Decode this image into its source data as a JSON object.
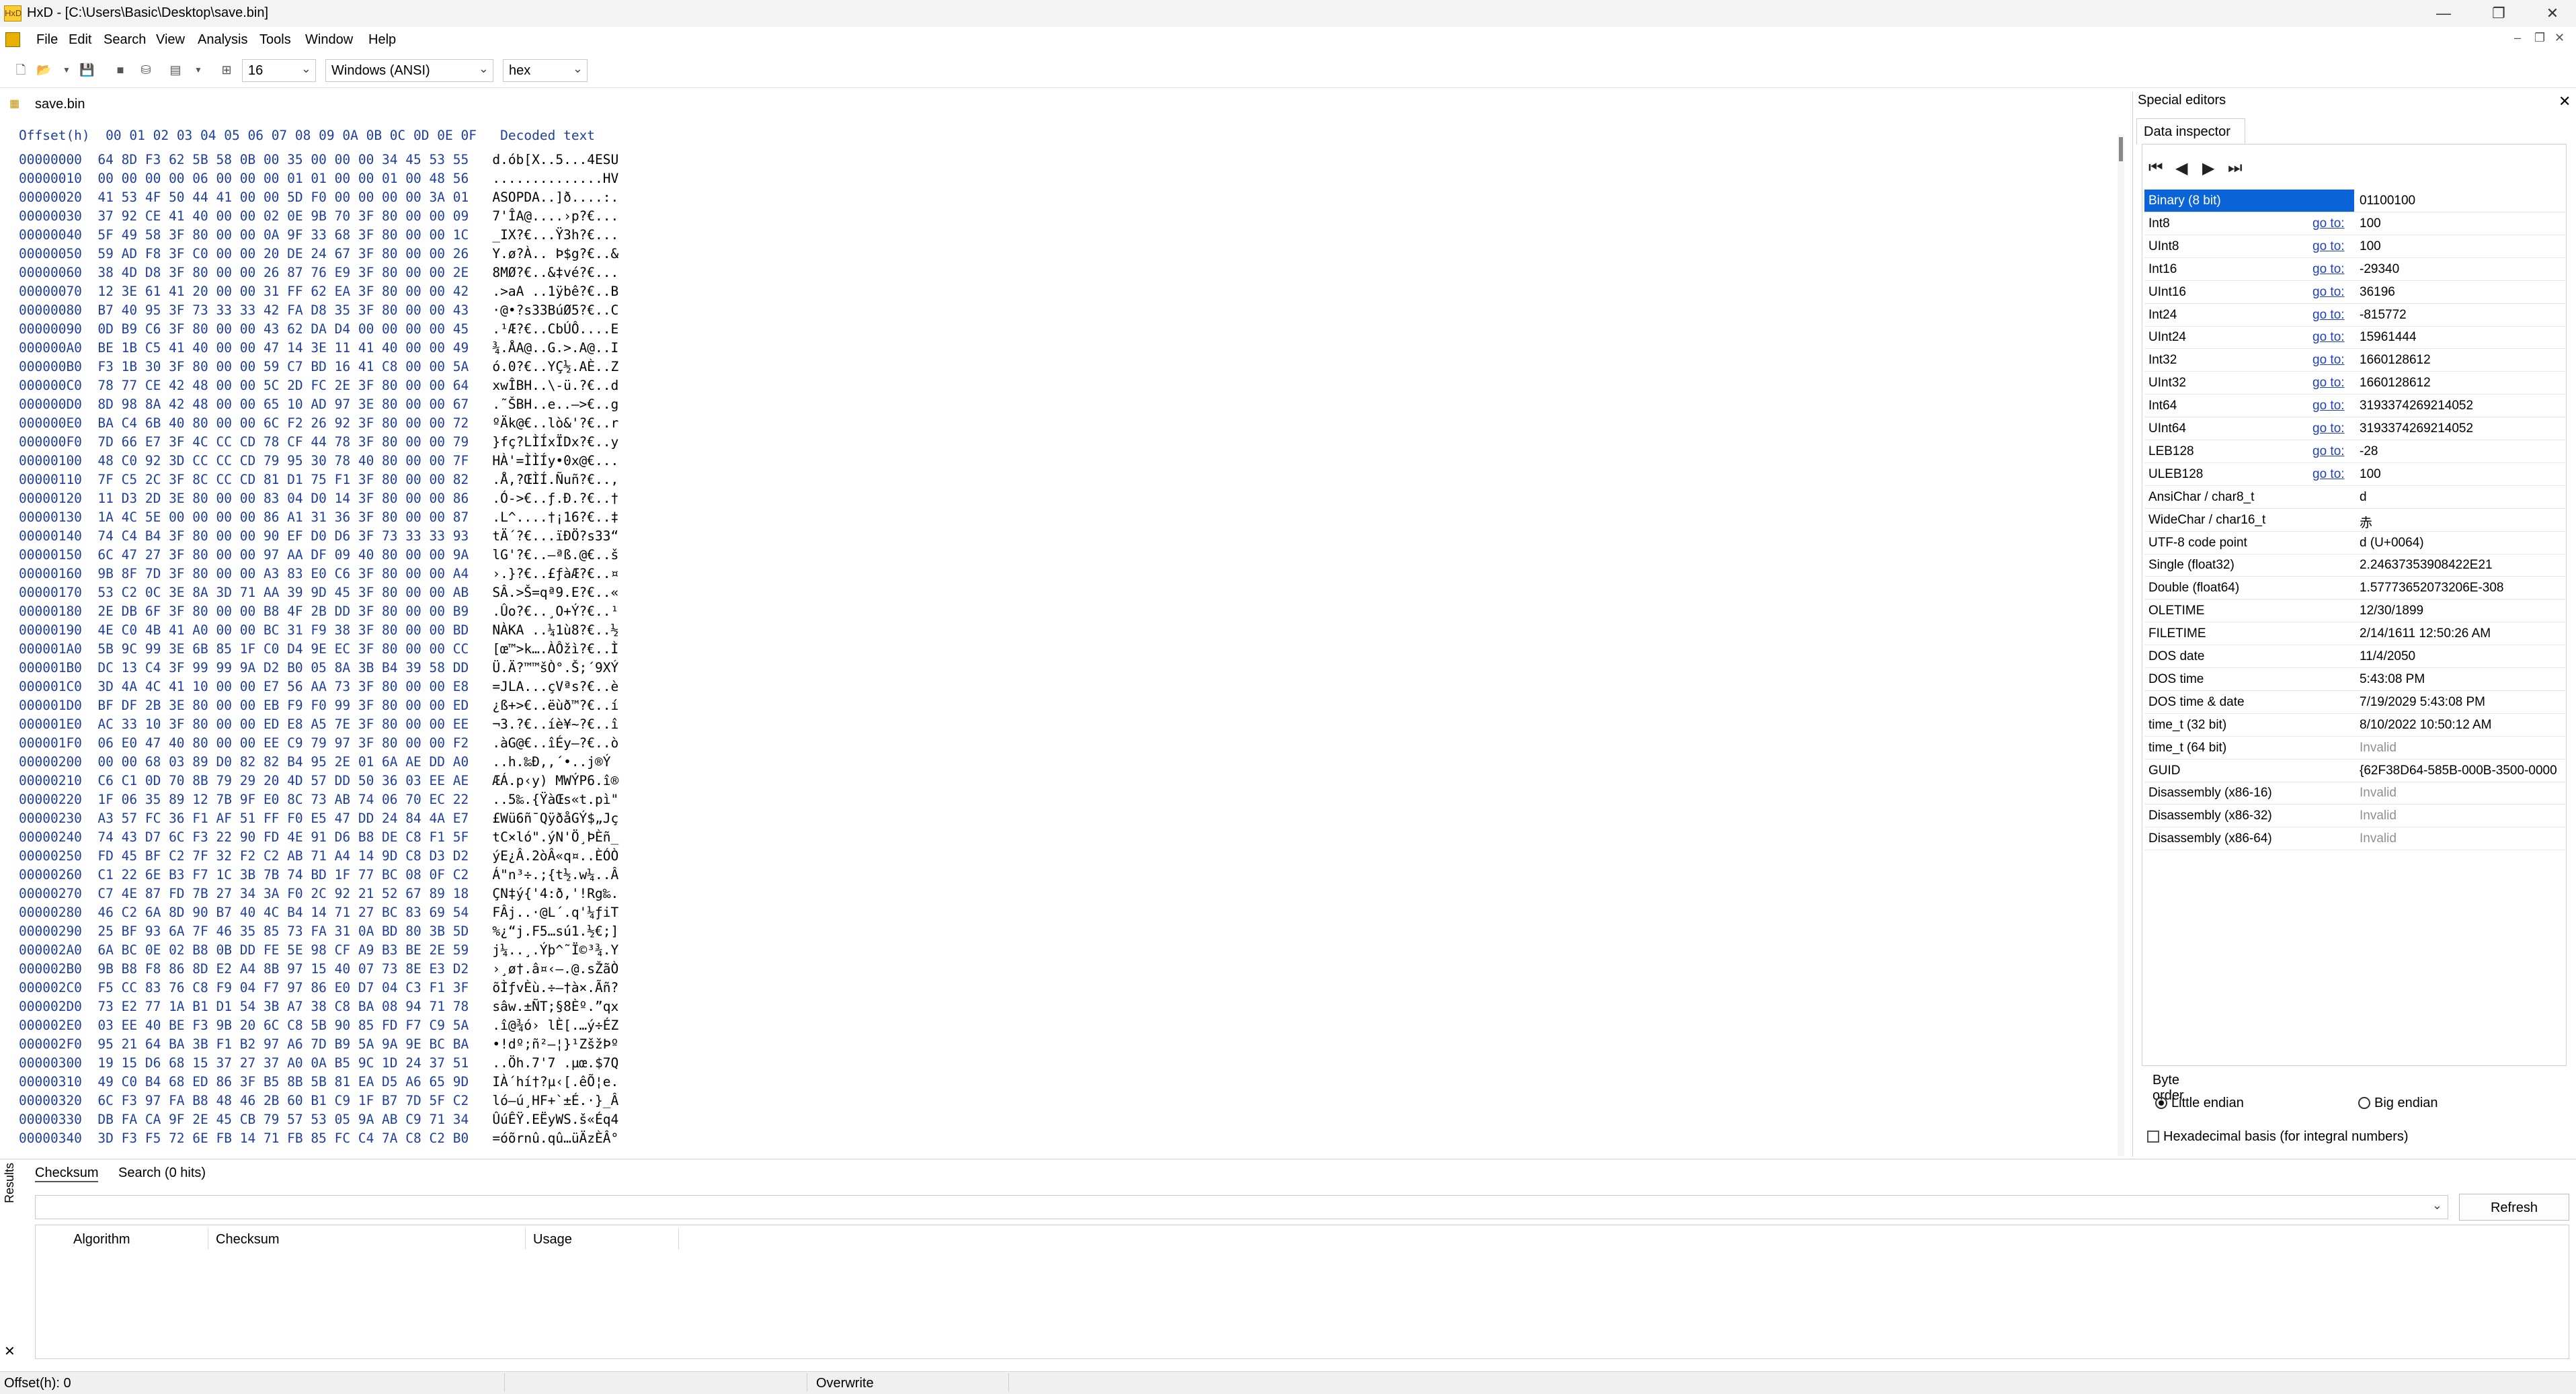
{
  "window": {
    "title": "HxD - [C:\\Users\\Basic\\Desktop\\save.bin]",
    "minimize": "—",
    "maximize": "❐",
    "close": "✕"
  },
  "menu": [
    "File",
    "Edit",
    "Search",
    "View",
    "Analysis",
    "Tools",
    "Window",
    "Help"
  ],
  "toolbar": {
    "bytes_per_row": "16",
    "charset": "Windows (ANSI)",
    "display": "hex"
  },
  "file_tab": "save.bin",
  "hex": {
    "header_offset": "Offset(h)",
    "header_columns": "00 01 02 03 04 05 06 07 08 09 0A 0B 0C 0D 0E 0F",
    "header_decoded": "Decoded text",
    "rows": [
      [
        "00000000",
        "64 8D F3 62 5B 58 0B 00 35 00 00 00 34 45 53 55",
        "d.ób[X..5...4ESU"
      ],
      [
        "00000010",
        "00 00 00 00 06 00 00 00 01 01 00 00 01 00 48 56",
        "..............HV"
      ],
      [
        "00000020",
        "41 53 4F 50 44 41 00 00 5D F0 00 00 00 00 3A 01",
        "ASOPDA..]ð....:."
      ],
      [
        "00000030",
        "37 92 CE 41 40 00 00 02 0E 9B 70 3F 80 00 00 09",
        "7'ÎA@....›p?€..."
      ],
      [
        "00000040",
        "5F 49 58 3F 80 00 00 0A 9F 33 68 3F 80 00 00 1C",
        "_IX?€...Ÿ3h?€..."
      ],
      [
        "00000050",
        "59 AD F8 3F C0 00 00 20 DE 24 67 3F 80 00 00 26",
        "Y.ø?À.. Þ$g?€..&"
      ],
      [
        "00000060",
        "38 4D D8 3F 80 00 00 26 87 76 E9 3F 80 00 00 2E",
        "8MØ?€..&‡vé?€..."
      ],
      [
        "00000070",
        "12 3E 61 41 20 00 00 31 FF 62 EA 3F 80 00 00 42",
        ".>aA ..1ÿbê?€..B"
      ],
      [
        "00000080",
        "B7 40 95 3F 73 33 33 42 FA D8 35 3F 80 00 00 43",
        "·@•?s33BúØ5?€..C"
      ],
      [
        "00000090",
        "0D B9 C6 3F 80 00 00 43 62 DA D4 00 00 00 00 45",
        ".¹Æ?€..CbÚÔ....E"
      ],
      [
        "000000A0",
        "BE 1B C5 41 40 00 00 47 14 3E 11 41 40 00 00 49",
        "¾.ÅA@..G.>.A@..I"
      ],
      [
        "000000B0",
        "F3 1B 30 3F 80 00 00 59 C7 BD 16 41 C8 00 00 5A",
        "ó.0?€..YÇ½.AÈ..Z"
      ],
      [
        "000000C0",
        "78 77 CE 42 48 00 00 5C 2D FC 2E 3F 80 00 00 64",
        "xwÎBH..\\-ü.?€..d"
      ],
      [
        "000000D0",
        "8D 98 8A 42 48 00 00 65 10 AD 97 3E 80 00 00 67",
        ".˜ŠBH..e..—>€..g"
      ],
      [
        "000000E0",
        "BA C4 6B 40 80 00 00 6C F2 26 92 3F 80 00 00 72",
        "ºÄk@€..lò&'?€..r"
      ],
      [
        "000000F0",
        "7D 66 E7 3F 4C CC CD 78 CF 44 78 3F 80 00 00 79",
        "}fç?LÌÍxÏDx?€..y"
      ],
      [
        "00000100",
        "48 C0 92 3D CC CC CD 79 95 30 78 40 80 00 00 7F",
        "HÀ'=ÌÌÍy•0x@€..."
      ],
      [
        "00000110",
        "7F C5 2C 3F 8C CC CD 81 D1 75 F1 3F 80 00 00 82",
        ".Å,?ŒÌÍ.Ñuñ?€..‚"
      ],
      [
        "00000120",
        "11 D3 2D 3E 80 00 00 83 04 D0 14 3F 80 00 00 86",
        ".Ó->€..ƒ.Ð.?€..†"
      ],
      [
        "00000130",
        "1A 4C 5E 00 00 00 00 86 A1 31 36 3F 80 00 00 87",
        ".L^....†¡16?€..‡"
      ],
      [
        "00000140",
        "74 C4 B4 3F 80 00 00 90 EF D0 D6 3F 73 33 33 93",
        "tÄ´?€...ïÐÖ?s33“"
      ],
      [
        "00000150",
        "6C 47 27 3F 80 00 00 97 AA DF 09 40 80 00 00 9A",
        "lG'?€..—ªß.@€..š"
      ],
      [
        "00000160",
        "9B 8F 7D 3F 80 00 00 A3 83 E0 C6 3F 80 00 00 A4",
        "›.}?€..£ƒàÆ?€..¤"
      ],
      [
        "00000170",
        "53 C2 0C 3E 8A 3D 71 AA 39 9D 45 3F 80 00 00 AB",
        "SÂ.>Š=qª9.E?€..«"
      ],
      [
        "00000180",
        "2E DB 6F 3F 80 00 00 B8 4F 2B DD 3F 80 00 00 B9",
        ".Ûo?€..¸O+Ý?€..¹"
      ],
      [
        "00000190",
        "4E C0 4B 41 A0 00 00 BC 31 F9 38 3F 80 00 00 BD",
        "NÀKA ..¼1ù8?€..½"
      ],
      [
        "000001A0",
        "5B 9C 99 3E 6B 85 1F C0 D4 9E EC 3F 80 00 00 CC",
        "[œ™>k….ÀÔžì?€..Ì"
      ],
      [
        "000001B0",
        "DC 13 C4 3F 99 99 9A D2 B0 05 8A 3B B4 39 58 DD",
        "Ü.Ä?™™šÒ°.Š;´9XÝ"
      ],
      [
        "000001C0",
        "3D 4A 4C 41 10 00 00 E7 56 AA 73 3F 80 00 00 E8",
        "=JLA...çVªs?€..è"
      ],
      [
        "000001D0",
        "BF DF 2B 3E 80 00 00 EB F9 F0 99 3F 80 00 00 ED",
        "¿ß+>€..ëùð™?€..í"
      ],
      [
        "000001E0",
        "AC 33 10 3F 80 00 00 ED E8 A5 7E 3F 80 00 00 EE",
        "¬3.?€..íè¥~?€..î"
      ],
      [
        "000001F0",
        "06 E0 47 40 80 00 00 EE C9 79 97 3F 80 00 00 F2",
        ".àG@€..îÉy—?€..ò"
      ],
      [
        "00000200",
        "00 00 68 03 89 D0 82 82 B4 95 2E 01 6A AE DD A0",
        "..h.‰Ð‚‚´•..j®Ý "
      ],
      [
        "00000210",
        "C6 C1 0D 70 8B 79 29 20 4D 57 DD 50 36 03 EE AE",
        "ÆÁ.p‹y) MWÝP6.î®"
      ],
      [
        "00000220",
        "1F 06 35 89 12 7B 9F E0 8C 73 AB 74 06 70 EC 22",
        "..5‰.{ŸàŒs«t.pì\""
      ],
      [
        "00000230",
        "A3 57 FC 36 F1 AF 51 FF F0 E5 47 DD 24 84 4A E7",
        "£Wü6ñ¯QÿðåGÝ$„Jç"
      ],
      [
        "00000240",
        "74 43 D7 6C F3 22 90 FD 4E 91 D6 B8 DE C8 F1 5F",
        "tC×ló\".ýN'Ö¸ÞÈñ_"
      ],
      [
        "00000250",
        "FD 45 BF C2 7F 32 F2 C2 AB 71 A4 14 9D C8 D3 D2",
        "ýE¿Â.2òÂ«q¤..ÈÓÒ"
      ],
      [
        "00000260",
        "C1 22 6E B3 F7 1C 3B 7B 74 BD 1F 77 BC 08 0F C2",
        "Á\"n³÷.;{t½.w¼..Â"
      ],
      [
        "00000270",
        "C7 4E 87 FD 7B 27 34 3A F0 2C 92 21 52 67 89 18",
        "ÇN‡ý{'4:ð,'!Rg‰."
      ],
      [
        "00000280",
        "46 C2 6A 8D 90 B7 40 4C B4 14 71 27 BC 83 69 54",
        "FÂj..·@L´.q'¼ƒiT"
      ],
      [
        "00000290",
        "25 BF 93 6A 7F 46 35 85 73 FA 31 0A BD 80 3B 5D",
        "%¿“j.F5…sú1.½€;]"
      ],
      [
        "000002A0",
        "6A BC 0E 02 B8 0B DD FE 5E 98 CF A9 B3 BE 2E 59",
        "j¼..¸.Ýþ^˜Ï©³¾.Y"
      ],
      [
        "000002B0",
        "9B B8 F8 86 8D E2 A4 8B 97 15 40 07 73 8E E3 D2",
        "›¸ø†.â¤‹—.@.sŽãÒ"
      ],
      [
        "000002C0",
        "F5 CC 83 76 C8 F9 04 F7 97 86 E0 D7 04 C3 F1 3F",
        "õÌƒvÈù.÷—†à×.Ãñ?"
      ],
      [
        "000002D0",
        "73 E2 77 1A B1 D1 54 3B A7 38 C8 BA 08 94 71 78",
        "sâw.±ÑT;§8Èº.”qx"
      ],
      [
        "000002E0",
        "03 EE 40 BE F3 9B 20 6C C8 5B 90 85 FD F7 C9 5A",
        ".î@¾ó› lÈ[.…ý÷ÉZ"
      ],
      [
        "000002F0",
        "95 21 64 BA 3B F1 B2 97 A6 7D B9 5A 9A 9E BC BA",
        "•!dº;ñ²—¦}¹ZšžÞº"
      ],
      [
        "00000300",
        "19 15 D6 68 15 37 27 37 A0 0A B5 9C 1D 24 37 51",
        "..Öh.7'7 .µœ.$7Q"
      ],
      [
        "00000310",
        "49 C0 B4 68 ED 86 3F B5 8B 5B 81 EA D5 A6 65 9D",
        "IÀ´hí†?µ‹[.êÕ¦e."
      ],
      [
        "00000320",
        "6C F3 97 FA B8 48 46 2B 60 B1 C9 1F B7 7D 5F C2",
        "ló—ú¸HF+`±É.·}_Â"
      ],
      [
        "00000330",
        "DB FA CA 9F 2E 45 CB 79 57 53 05 9A AB C9 71 34",
        "ÛúÊŸ.EËyWS.š«Éq4"
      ],
      [
        "00000340",
        "3D F3 F5 72 6E FB 14 71 FB 85 FC C4 7A C8 C2 B0",
        "=óõrnû.qû…üÄzÈÂ°"
      ]
    ]
  },
  "special_editors": {
    "title": "Special editors",
    "close": "✕",
    "tab": "Data inspector",
    "nav": [
      "⏮",
      "◀",
      "▶",
      "⏭"
    ],
    "goto_label": "go to:",
    "rows": [
      {
        "name": "Binary (8 bit)",
        "goto": false,
        "value": "01100100",
        "selected": true
      },
      {
        "name": "Int8",
        "goto": true,
        "value": "100"
      },
      {
        "name": "UInt8",
        "goto": true,
        "value": "100"
      },
      {
        "name": "Int16",
        "goto": true,
        "value": "-29340"
      },
      {
        "name": "UInt16",
        "goto": true,
        "value": "36196"
      },
      {
        "name": "Int24",
        "goto": true,
        "value": "-815772"
      },
      {
        "name": "UInt24",
        "goto": true,
        "value": "15961444"
      },
      {
        "name": "Int32",
        "goto": true,
        "value": "1660128612"
      },
      {
        "name": "UInt32",
        "goto": true,
        "value": "1660128612"
      },
      {
        "name": "Int64",
        "goto": true,
        "value": "3193374269214052"
      },
      {
        "name": "UInt64",
        "goto": true,
        "value": "3193374269214052"
      },
      {
        "name": "LEB128",
        "goto": true,
        "value": "-28"
      },
      {
        "name": "ULEB128",
        "goto": true,
        "value": "100"
      },
      {
        "name": "AnsiChar / char8_t",
        "goto": false,
        "value": "d"
      },
      {
        "name": "WideChar / char16_t",
        "goto": false,
        "value": "赤"
      },
      {
        "name": "UTF-8 code point",
        "goto": false,
        "value": "d (U+0064)"
      },
      {
        "name": "Single (float32)",
        "goto": false,
        "value": "2.24637353908422E21"
      },
      {
        "name": "Double (float64)",
        "goto": false,
        "value": "1.57773652073206E-308"
      },
      {
        "name": "OLETIME",
        "goto": false,
        "value": "12/30/1899"
      },
      {
        "name": "FILETIME",
        "goto": false,
        "value": "2/14/1611 12:50:26 AM"
      },
      {
        "name": "DOS date",
        "goto": false,
        "value": "11/4/2050"
      },
      {
        "name": "DOS time",
        "goto": false,
        "value": "5:43:08 PM"
      },
      {
        "name": "DOS time & date",
        "goto": false,
        "value": "7/19/2029 5:43:08 PM"
      },
      {
        "name": "time_t (32 bit)",
        "goto": false,
        "value": "8/10/2022 10:50:12 AM"
      },
      {
        "name": "time_t (64 bit)",
        "goto": false,
        "value": "Invalid",
        "invalid": true
      },
      {
        "name": "GUID",
        "goto": false,
        "value": "{62F38D64-585B-000B-3500-0000"
      },
      {
        "name": "Disassembly (x86-16)",
        "goto": false,
        "value": "Invalid",
        "invalid": true
      },
      {
        "name": "Disassembly (x86-32)",
        "goto": false,
        "value": "Invalid",
        "invalid": true
      },
      {
        "name": "Disassembly (x86-64)",
        "goto": false,
        "value": "Invalid",
        "invalid": true
      }
    ],
    "byte_order_label": "Byte order",
    "little_endian": "Little endian",
    "big_endian": "Big endian",
    "hex_basis": "Hexadecimal basis (for integral numbers)"
  },
  "results": {
    "side_label": "Results",
    "tabs": [
      "Checksum",
      "Search (0 hits)"
    ],
    "refresh": "Refresh",
    "columns": [
      "Algorithm",
      "Checksum",
      "Usage"
    ],
    "close": "✕"
  },
  "status": {
    "offset": "Offset(h): 0",
    "mode": "Overwrite"
  }
}
